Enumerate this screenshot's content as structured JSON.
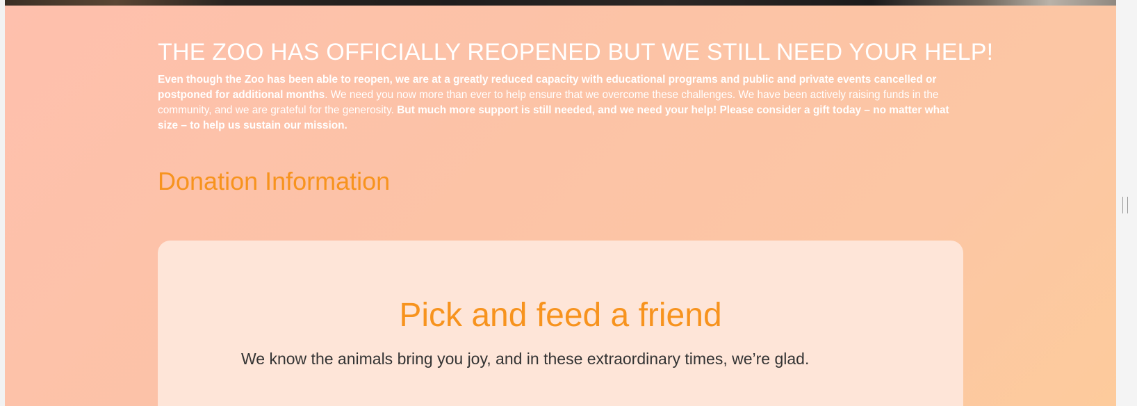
{
  "hero": {
    "title": "THE ZOO HAS OFFICIALLY REOPENED BUT WE STILL NEED YOUR HELP!",
    "intro_bold_1": "Even though the Zoo has been able to reopen, we are at a greatly reduced capacity with educational programs and public and private events cancelled or postponed for additional months",
    "intro_normal": ". We need you now more than ever to help ensure that we overcome these challenges. We have been actively raising funds in the community, and we are grateful for the generosity.  ",
    "intro_bold_2": "But much more support is still needed, and we need your help! Please consider a gift today – no matter what size – to help us sustain our mission."
  },
  "donation": {
    "section_title": "Donation Information",
    "card_title": "Pick and feed a friend",
    "card_text": "We know the animals bring you joy, and in these extraordinary times, we’re glad."
  },
  "colors": {
    "accent": "#f7931e",
    "card_bg": "#fee5d8",
    "hero_text": "#ffffff",
    "body_text": "#333333"
  }
}
